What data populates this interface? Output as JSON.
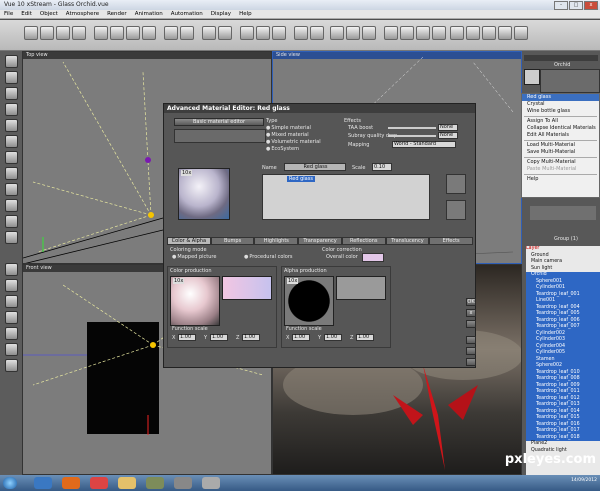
{
  "window": {
    "title": "Vue 10 xStream - Glass Orchid.vue",
    "buttons": [
      "-",
      "□",
      "x"
    ]
  },
  "menu": [
    "File",
    "Edit",
    "Object",
    "Atmosphere",
    "Render",
    "Animation",
    "Automation",
    "Display",
    "Help"
  ],
  "viewports": {
    "top": "Top view",
    "side": "Side view",
    "front": "Front view"
  },
  "dialog": {
    "title": "Advanced Material Editor: Red glass",
    "basic_button": "Basic material editor",
    "type_label": "Type",
    "types": [
      "Simple material",
      "Mixed material",
      "Volumetric material",
      "EcoSystem"
    ],
    "effects_label": "Effects",
    "taa_label": "TAA boost",
    "taa_value": "None",
    "subray_label": "Subray quality drop",
    "subray_value": "None",
    "mapping_label": "Mapping",
    "mapping_value": "World - Standard",
    "name_label": "Name",
    "name_value": "Red glass",
    "scale_label": "Scale",
    "scale_value": "0.10",
    "layer_item": "Red glass",
    "preview_badge": "10x",
    "tabs": [
      "Color & Alpha",
      "Bumps",
      "Highlights",
      "Transparency",
      "Reflections",
      "Translucency",
      "Effects"
    ],
    "coloring_mode_label": "Coloring mode",
    "mapped_picture": "Mapped picture",
    "procedural_colors": "Procedural colors",
    "color_correction_label": "Color correction",
    "overall_color_label": "Overall color",
    "color_production": "Color production",
    "alpha_production": "Alpha production",
    "function_scale": "Function scale",
    "x_label": "X",
    "y_label": "Y",
    "z_label": "Z",
    "fs_value": "1.00",
    "ok_button": "OK",
    "close_button": "x"
  },
  "context_menu": {
    "items": [
      "Red glass",
      "Crystal",
      "Wine bottle glass"
    ],
    "actions": [
      "Assign To All",
      "Collapse Identical Materials",
      "Edit All Materials"
    ],
    "multi": [
      "Load Multi-Material",
      "Save Multi-Material"
    ],
    "copy": [
      "Copy Multi-Material",
      "Paste Multi-Material"
    ],
    "help": "Help"
  },
  "right_panel": {
    "orchid_label": "Orchid",
    "group_label": "Group (1)"
  },
  "tree": [
    "Layer",
    "Ground",
    "Main camera",
    "Sun light",
    "Orchid",
    "Sphere001",
    "Cylinder001",
    "Teardrop_leaf_001",
    "Line001",
    "Teardrop_leaf_004",
    "Teardrop_leaf_005",
    "Teardrop_leaf_006",
    "Teardrop_leaf_007",
    "Cylinder002",
    "Cylinder003",
    "Cylinder004",
    "Cylinder005",
    "Stamen",
    "Sphere002",
    "Teardrop_leaf_010",
    "Teardrop_leaf_008",
    "Teardrop_leaf_009",
    "Teardrop_leaf_011",
    "Teardrop_leaf_012",
    "Teardrop_leaf_013",
    "Teardrop_leaf_014",
    "Teardrop_leaf_015",
    "Teardrop_leaf_016",
    "Teardrop_leaf_017",
    "Teardrop_leaf_018",
    "Plane2",
    "Quadratic light"
  ],
  "watermark": "pxleyes.com",
  "clock": {
    "time": "",
    "date": "14/09/2012"
  },
  "colors": {
    "accent": "#2e67c4",
    "overall_color": "#e3c7e8"
  }
}
